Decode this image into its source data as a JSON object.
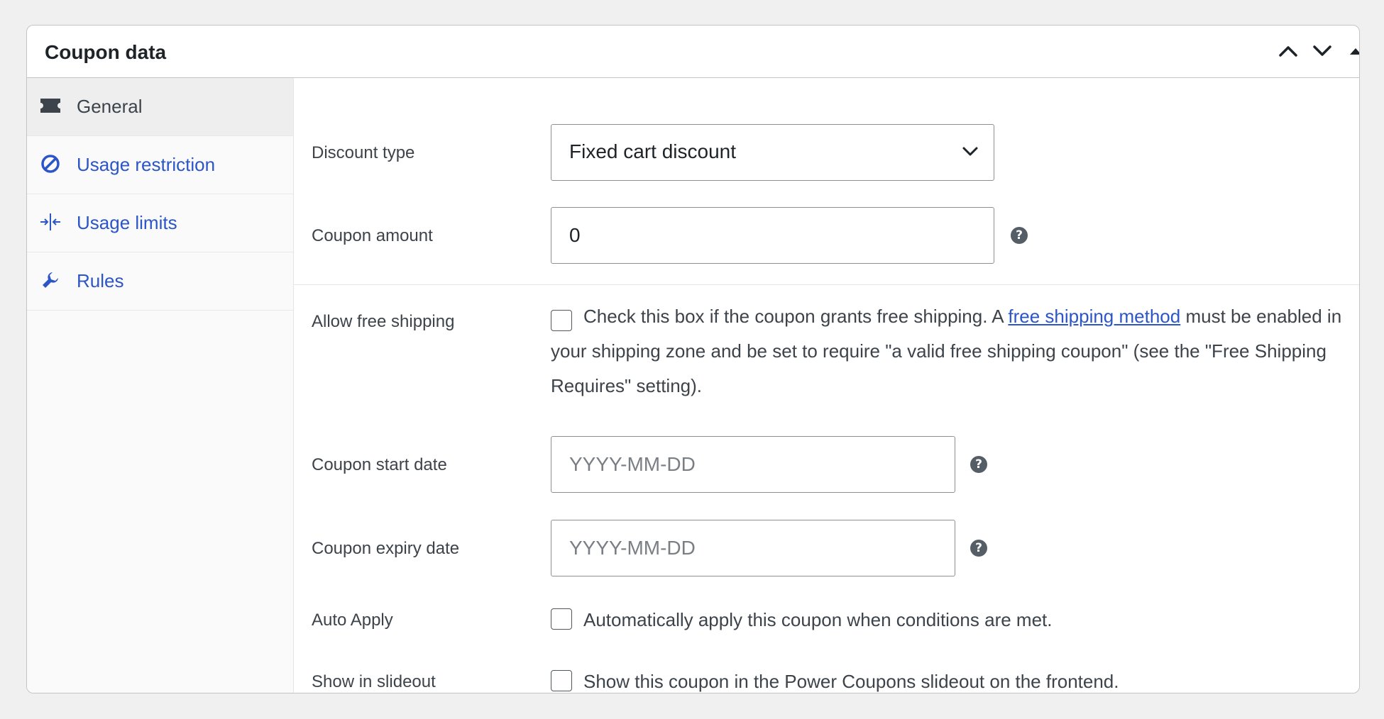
{
  "panel": {
    "title": "Coupon data",
    "controls": [
      "move-up",
      "move-down",
      "collapse"
    ]
  },
  "tabs": [
    {
      "label": "General",
      "icon": "ticket-icon",
      "active": true
    },
    {
      "label": "Usage restriction",
      "icon": "block-icon",
      "active": false
    },
    {
      "label": "Usage limits",
      "icon": "limits-icon",
      "active": false
    },
    {
      "label": "Rules",
      "icon": "wrench-icon",
      "active": false
    }
  ],
  "fields": {
    "discount_type": {
      "label": "Discount type",
      "value": "Fixed cart discount"
    },
    "coupon_amount": {
      "label": "Coupon amount",
      "value": "0"
    },
    "free_shipping": {
      "label": "Allow free shipping",
      "text_before": "Check this box if the coupon grants free shipping. A",
      "link": "free shipping method",
      "text_after": "must be enabled in your shipping zone and be set to require \"a valid free shipping coupon\" (see the \"Free Shipping Requires\" setting).",
      "checked": false
    },
    "start_date": {
      "label": "Coupon start date",
      "placeholder": "YYYY-MM-DD"
    },
    "expiry_date": {
      "label": "Coupon expiry date",
      "placeholder": "YYYY-MM-DD"
    },
    "auto_apply": {
      "label": "Auto Apply",
      "text": "Automatically apply this coupon when conditions are met.",
      "checked": false
    },
    "slideout": {
      "label": "Show in slideout",
      "text": "Show this coupon in the Power Coupons slideout on the frontend.",
      "checked": false
    }
  },
  "help_glyph": "?",
  "colors": {
    "accent": "#2c55c8",
    "active_tab_bg": "#eeeeee",
    "border": "#8c8f94"
  }
}
